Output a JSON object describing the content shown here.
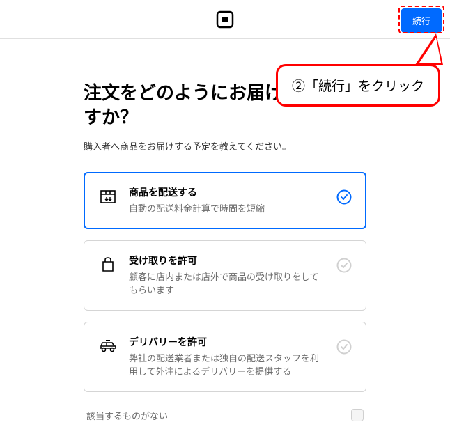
{
  "header": {
    "continue_label": "続行"
  },
  "callout": {
    "text": "②「続行」をクリック"
  },
  "page": {
    "title": "注文をどのようにお届けの予定ですか？",
    "subtitle": "購入者へ商品をお届けする予定を教えてください。"
  },
  "options": [
    {
      "title": "商品を配送する",
      "description": "自動の配送料金計算で時間を短縮"
    },
    {
      "title": "受け取りを許可",
      "description": "顧客に店内または店外で商品の受け取りをしてもらいます"
    },
    {
      "title": "デリバリーを許可",
      "description": "弊社の配送業者または独自の配送スタッフを利用して外注によるデリバリーを提供する"
    }
  ],
  "none_option": {
    "label": "該当するものがない"
  }
}
